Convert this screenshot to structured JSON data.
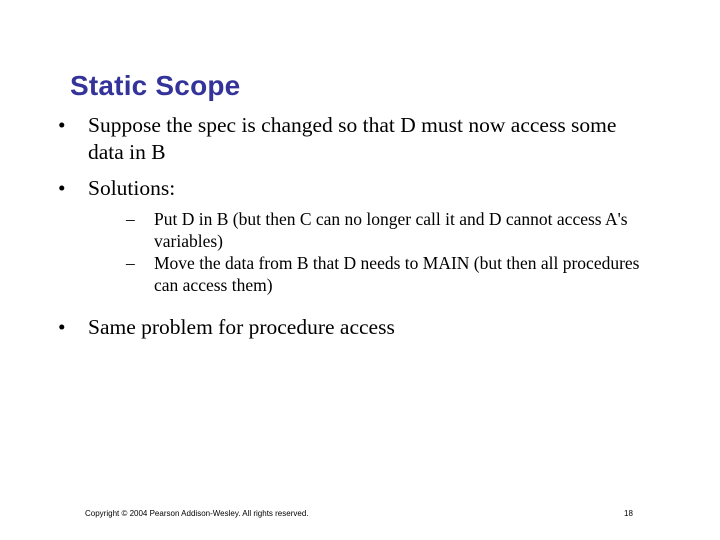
{
  "slide": {
    "title": "Static Scope",
    "title_color": "#333399",
    "background_color": "#ffffff",
    "text_color": "#000000"
  },
  "bullets": [
    {
      "level": 1,
      "marker": "•",
      "text": "Suppose the spec is changed so that D must now access some data in B"
    },
    {
      "level": 1,
      "marker": "•",
      "text": "Solutions:"
    },
    {
      "level": 2,
      "marker": "–",
      "text": "Put D in B (but then C can no longer call it and D cannot access A's variables)"
    },
    {
      "level": 2,
      "marker": "–",
      "text": "Move the data from B that D needs to MAIN (but then all procedures can access them)"
    },
    {
      "level": 1,
      "marker": "•",
      "text": "Same problem for procedure access"
    }
  ],
  "footer": {
    "copyright": "Copyright © 2004 Pearson Addison-Wesley. All rights reserved.",
    "page_number": "18"
  }
}
